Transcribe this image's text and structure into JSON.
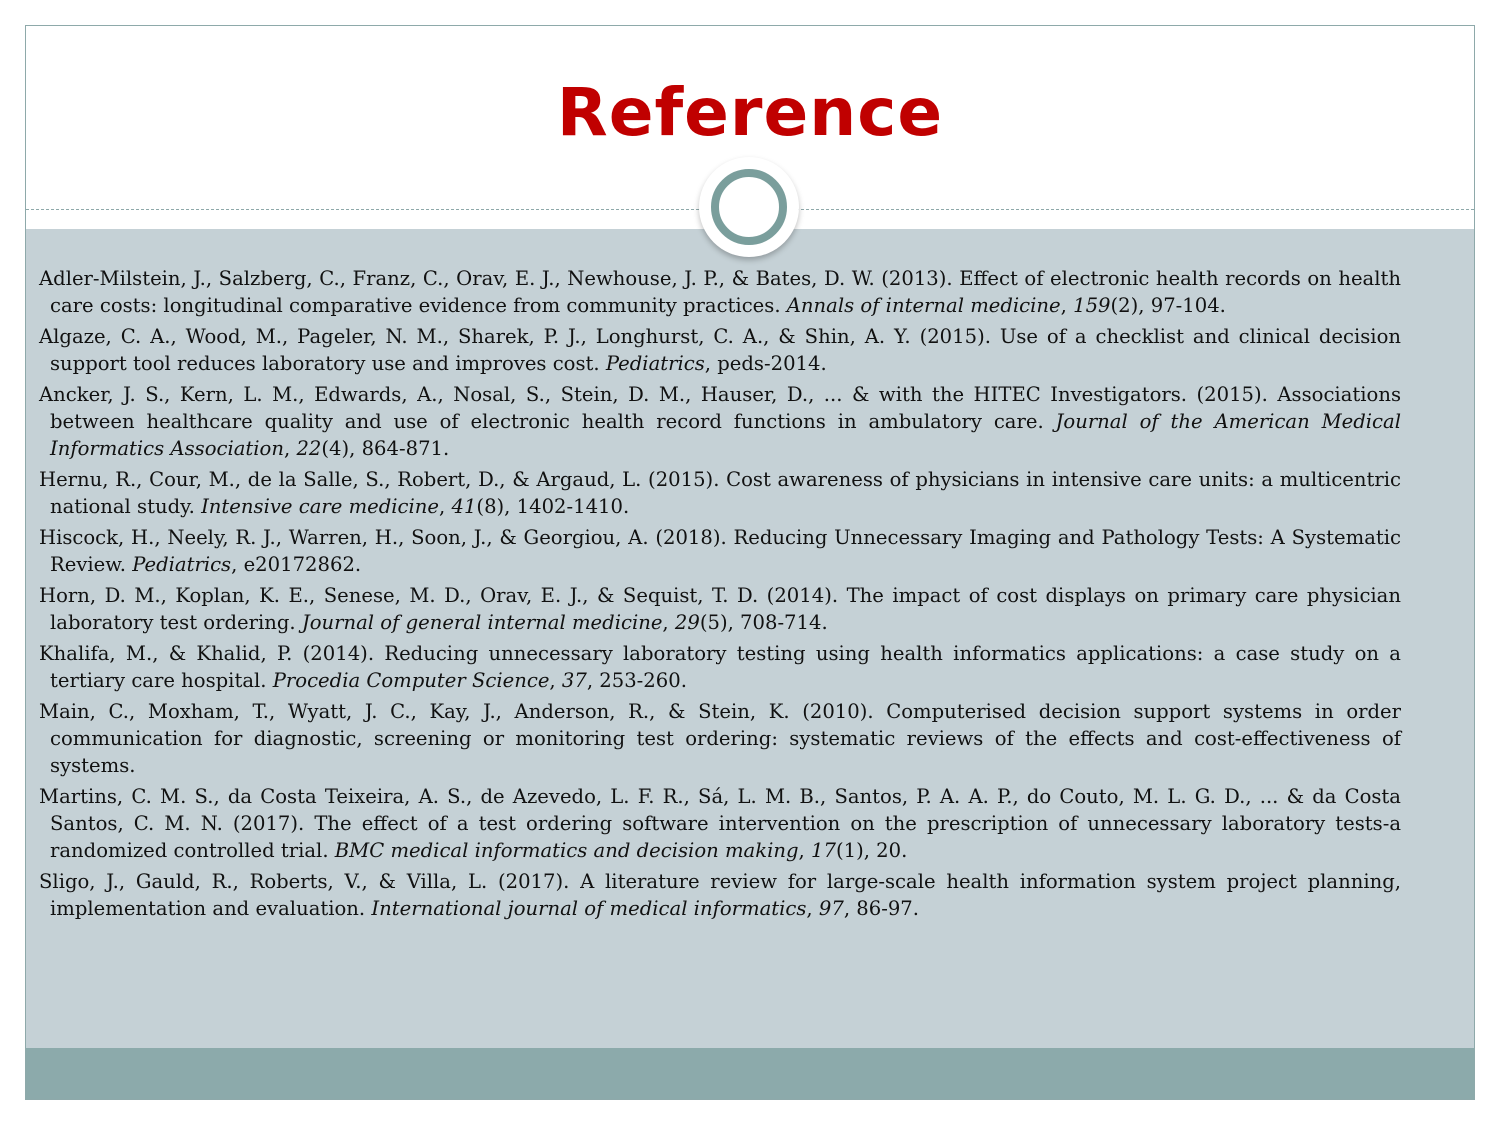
{
  "slide": {
    "title": "Reference",
    "colors": {
      "title": "#c00000",
      "body_bg": "#c5d1d6",
      "footer_bg": "#8caaab",
      "ring": "#7a9e9c"
    },
    "references": [
      {
        "parts": [
          {
            "t": "Adler-Milstein, J., Salzberg, C., Franz, C., Orav, E. J., Newhouse, J. P., & Bates, D. W. (2013). Effect of electronic health records on health care costs: longitudinal comparative evidence from community practices. "
          },
          {
            "t": "Annals of internal medicine",
            "i": true
          },
          {
            "t": ", "
          },
          {
            "t": "159",
            "i": true
          },
          {
            "t": "(2), 97-104."
          }
        ]
      },
      {
        "parts": [
          {
            "t": "Algaze, C. A., Wood, M., Pageler, N. M., Sharek, P. J., Longhurst, C. A., & Shin, A. Y. (2015). Use of a checklist and clinical decision support tool reduces laboratory use and improves cost. "
          },
          {
            "t": "Pediatrics",
            "i": true
          },
          {
            "t": ", peds-2014."
          }
        ]
      },
      {
        "parts": [
          {
            "t": "Ancker, J. S., Kern, L. M., Edwards, A., Nosal, S., Stein, D. M., Hauser, D., ... & with the HITEC Investigators. (2015). Associations between healthcare quality and use of electronic health record functions in ambulatory care. "
          },
          {
            "t": "Journal of the American Medical Informatics Association",
            "i": true
          },
          {
            "t": ", "
          },
          {
            "t": "22",
            "i": true
          },
          {
            "t": "(4), 864-871."
          }
        ]
      },
      {
        "parts": [
          {
            "t": "Hernu, R., Cour, M., de la Salle, S., Robert, D., & Argaud, L. (2015). Cost awareness of physicians in intensive care units: a multicentric national study. "
          },
          {
            "t": "Intensive care medicine",
            "i": true
          },
          {
            "t": ", "
          },
          {
            "t": "41",
            "i": true
          },
          {
            "t": "(8), 1402-1410."
          }
        ]
      },
      {
        "parts": [
          {
            "t": "Hiscock, H., Neely, R. J., Warren, H., Soon, J., & Georgiou, A. (2018). Reducing Unnecessary Imaging and Pathology Tests: A Systematic Review. "
          },
          {
            "t": "Pediatrics",
            "i": true
          },
          {
            "t": ", e20172862."
          }
        ]
      },
      {
        "parts": [
          {
            "t": "Horn, D. M., Koplan, K. E., Senese, M. D., Orav, E. J., & Sequist, T. D. (2014). The impact of cost displays on primary care physician laboratory test ordering. "
          },
          {
            "t": "Journal of general internal medicine",
            "i": true
          },
          {
            "t": ", "
          },
          {
            "t": "29",
            "i": true
          },
          {
            "t": "(5), 708-714."
          }
        ]
      },
      {
        "parts": [
          {
            "t": "Khalifa, M., & Khalid, P. (2014). Reducing unnecessary laboratory testing using health informatics applications: a case study on a tertiary care hospital. "
          },
          {
            "t": "Procedia Computer Science",
            "i": true
          },
          {
            "t": ", "
          },
          {
            "t": "37",
            "i": true
          },
          {
            "t": ", 253-260."
          }
        ]
      },
      {
        "parts": [
          {
            "t": "Main, C., Moxham, T., Wyatt, J. C., Kay, J., Anderson, R., & Stein, K. (2010). Computerised decision support systems in order communication for diagnostic, screening or monitoring test ordering: systematic reviews of the effects and cost-effectiveness of systems."
          }
        ]
      },
      {
        "parts": [
          {
            "t": "Martins, C. M. S., da Costa Teixeira, A. S., de Azevedo, L. F. R., Sá, L. M. B., Santos, P. A. A. P., do Couto, M. L. G. D., ... & da Costa Santos, C. M. N. (2017). The effect of a test ordering software intervention on the prescription of unnecessary laboratory tests-a randomized controlled trial. "
          },
          {
            "t": "BMC medical informatics and decision making",
            "i": true
          },
          {
            "t": ", "
          },
          {
            "t": "17",
            "i": true
          },
          {
            "t": "(1), 20."
          }
        ]
      },
      {
        "parts": [
          {
            "t": "Sligo, J., Gauld, R., Roberts, V., & Villa, L. (2017). A literature review for large-scale health information system project planning, implementation and evaluation. "
          },
          {
            "t": "International journal of medical informatics",
            "i": true
          },
          {
            "t": ", "
          },
          {
            "t": "97",
            "i": true
          },
          {
            "t": ", 86-97."
          }
        ]
      }
    ]
  }
}
